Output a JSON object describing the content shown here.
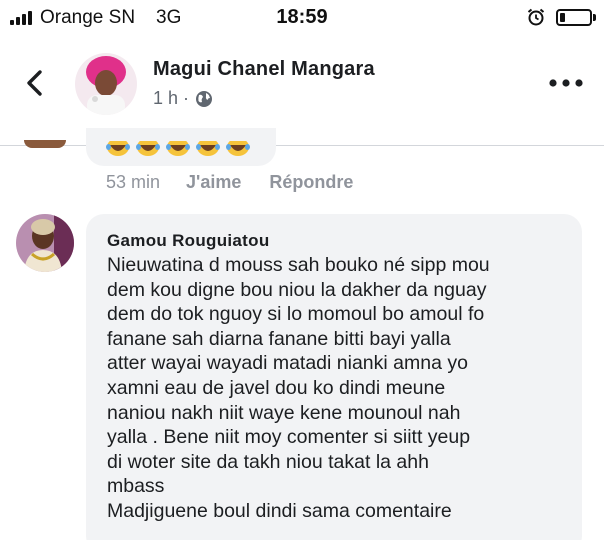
{
  "status_bar": {
    "carrier": "Orange SN",
    "network": "3G",
    "time": "18:59",
    "battery_level_percent": 18,
    "icons": [
      "signal-icon",
      "alarm-icon",
      "battery-icon"
    ]
  },
  "header": {
    "profile_name": "Magui Chanel Mangara",
    "post_age": "1 h ·",
    "privacy_icon": "globe-icon",
    "more_icon": "more-options-icon",
    "back_icon": "back-chevron-icon"
  },
  "previous_comment": {
    "emojis": [
      "😂",
      "😂",
      "😂",
      "😂",
      "😂"
    ],
    "time": "53 min",
    "like_label": "J'aime",
    "reply_label": "Répondre"
  },
  "comment": {
    "author": "Gamou Rouguiatou",
    "lines": [
      "Nieuwatina d mouss sah bouko né sipp mou",
      "dem kou digne bou niou la dakher da nguay",
      "dem do tok nguoy si lo momoul bo amoul fo",
      "fanane sah diarna fanane bitti bayi yalla",
      "atter wayai wayadi matadi nianki amna yo",
      "xamni eau de javel dou ko dindi meune",
      "naniou nakh niit waye kene mounoul nah",
      "yalla .  Bene niit moy comenter si siitt yeup",
      "di woter site da takh niou takat la ahh",
      "mbass",
      "Madjiguene boul dindi sama comentaire"
    ]
  },
  "colors": {
    "bubble": "#f2f3f5",
    "meta_text": "#90949c",
    "primary_text": "#1c1e21",
    "avatar_accent": "#e0308a"
  }
}
